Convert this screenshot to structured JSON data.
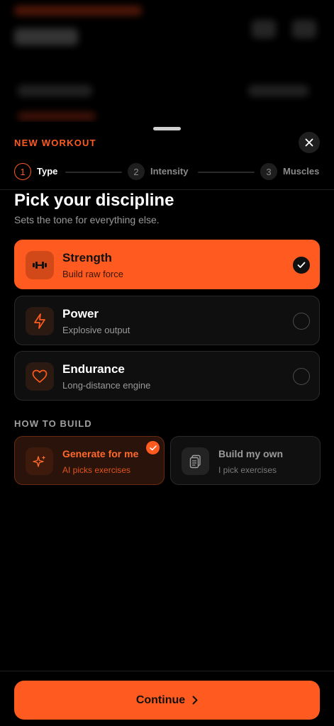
{
  "sheet": {
    "label": "NEW WORKOUT",
    "close_icon": "close-icon"
  },
  "stepper": {
    "steps": [
      {
        "number": "1",
        "label": "Type",
        "state": "active"
      },
      {
        "number": "2",
        "label": "Intensity",
        "state": "idle"
      },
      {
        "number": "3",
        "label": "Muscles",
        "state": "idle"
      }
    ]
  },
  "main": {
    "title": "Pick your discipline",
    "subtitle": "Sets the tone for everything else."
  },
  "disciplines": [
    {
      "title": "Strength",
      "subtitle": "Build raw force",
      "icon": "dumbbell-icon",
      "selected": true
    },
    {
      "title": "Power",
      "subtitle": "Explosive output",
      "icon": "lightning-icon",
      "selected": false
    },
    {
      "title": "Endurance",
      "subtitle": "Long-distance engine",
      "icon": "heart-icon",
      "selected": false
    }
  ],
  "build": {
    "section_label": "HOW TO BUILD",
    "options": [
      {
        "title": "Generate for me",
        "subtitle": "AI picks exercises",
        "icon": "sparkles-icon",
        "selected": true
      },
      {
        "title": "Build my own",
        "subtitle": "I pick exercises",
        "icon": "clipboard-icon",
        "selected": false
      }
    ]
  },
  "footer": {
    "continue_label": "Continue",
    "continue_icon": "chevron-right-icon"
  },
  "colors": {
    "accent": "#ff5a1f",
    "background": "#000000",
    "card": "#0f0f0f"
  }
}
